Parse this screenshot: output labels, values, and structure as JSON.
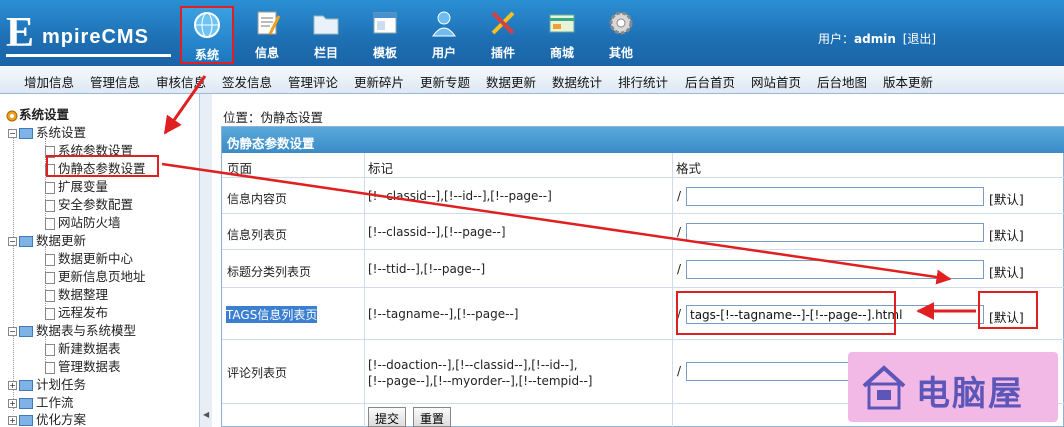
{
  "header": {
    "logo_initial": "E",
    "logo_rest": "mpireCMS",
    "nav": [
      {
        "label": "系统",
        "icon": "globe-icon"
      },
      {
        "label": "信息",
        "icon": "notepad-icon"
      },
      {
        "label": "栏目",
        "icon": "folder-icon"
      },
      {
        "label": "模板",
        "icon": "window-icon"
      },
      {
        "label": "用户",
        "icon": "user-icon"
      },
      {
        "label": "插件",
        "icon": "tools-icon"
      },
      {
        "label": "商城",
        "icon": "store-card-icon"
      },
      {
        "label": "其他",
        "icon": "gear-icon"
      }
    ],
    "user_label": "用户：",
    "username": "admin",
    "logout": "[退出]"
  },
  "subnav": [
    "增加信息",
    "管理信息",
    "审核信息",
    "签发信息",
    "管理评论",
    "更新碎片",
    "更新专题",
    "数据更新",
    "数据统计",
    "排行统计",
    "后台首页",
    "网站首页",
    "后台地图",
    "版本更新"
  ],
  "sidebar": {
    "title": "系统设置",
    "items": [
      "系统设置",
      "系统参数设置",
      "伪静态参数设置",
      "扩展变量",
      "安全参数配置",
      "网站防火墙",
      "数据更新",
      "数据更新中心",
      "更新信息页地址",
      "数据整理",
      "远程发布",
      "数据表与系统模型",
      "新建数据表",
      "管理数据表",
      "计划任务",
      "工作流",
      "优化方案"
    ]
  },
  "main": {
    "location": "位置：伪静态设置",
    "panel_title": "伪静态参数设置",
    "col_page": "页面",
    "col_tag": "标记",
    "col_format": "格式",
    "slash": "/",
    "default_label": "[默认]",
    "rows": [
      {
        "page": "信息内容页",
        "tag": "[!--classid--],[!--id--],[!--page--]",
        "format": ""
      },
      {
        "page": "信息列表页",
        "tag": "[!--classid--],[!--page--]",
        "format": ""
      },
      {
        "page": "标题分类列表页",
        "tag": "[!--ttid--],[!--page--]",
        "format": ""
      },
      {
        "page": "TAGS信息列表页",
        "tag": "[!--tagname--],[!--page--]",
        "format": "tags-[!--tagname--]-[!--page--].html"
      },
      {
        "page": "评论列表页",
        "tag": "[!--doaction--],[!--classid--],[!--id--],",
        "tag2": "[!--page--],[!--myorder--],[!--tempid--]",
        "format": ""
      }
    ],
    "submit": "提交",
    "reset": "重置"
  },
  "watermark": "电脑屋",
  "colors": {
    "header": "#1e6fb3",
    "annotation": "#e02020",
    "watermark_bg": "#f3b9e6",
    "watermark_text": "#5c56b8"
  }
}
